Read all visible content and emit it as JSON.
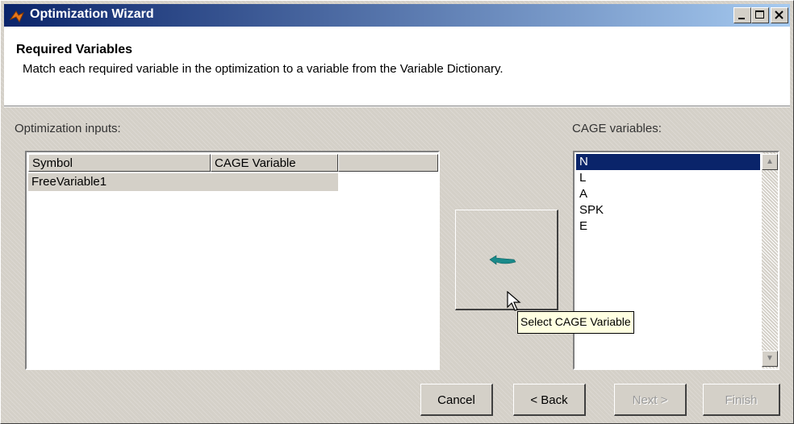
{
  "window": {
    "title": "Optimization Wizard",
    "caption_buttons": [
      "minimize-icon",
      "maximize-icon",
      "close-icon"
    ]
  },
  "header": {
    "title": "Required Variables",
    "description": "Match each required variable in the optimization to a variable from the Variable Dictionary."
  },
  "inputs_panel": {
    "label": "Optimization inputs:",
    "columns": [
      "Symbol",
      "CAGE Variable",
      ""
    ],
    "rows": [
      {
        "symbol": "FreeVariable1",
        "cage_variable": ""
      }
    ]
  },
  "cage_panel": {
    "label": "CAGE variables:",
    "items": [
      "N",
      "L",
      "A",
      "SPK",
      "E"
    ],
    "selected": "N"
  },
  "assign_button": {
    "icon": "assign-arrow-icon",
    "tooltip": "Select CAGE Variable"
  },
  "footer": {
    "cancel": "Cancel",
    "back": "< Back",
    "next": "Next >",
    "finish": "Finish"
  },
  "colors": {
    "title_bar_start": "#0a246a",
    "title_bar_end": "#a6caf0",
    "selection": "#0a246a",
    "arrow": "#1a8a8a"
  }
}
